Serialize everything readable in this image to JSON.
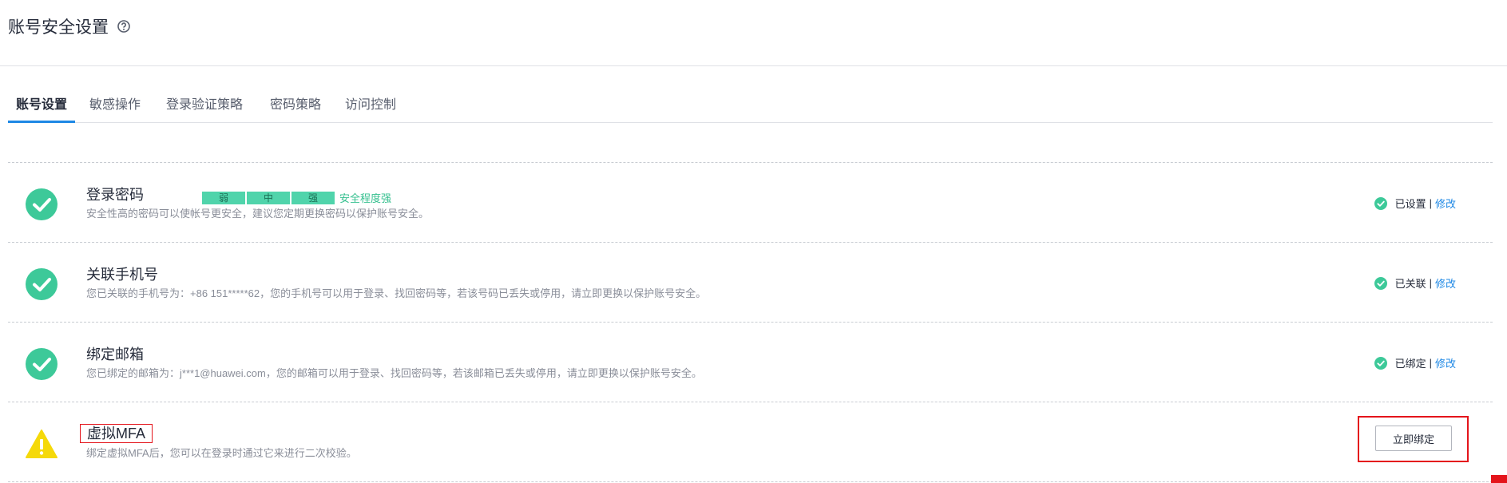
{
  "page": {
    "title": "账号安全设置"
  },
  "tabs": [
    {
      "label": "账号设置",
      "active": true
    },
    {
      "label": "敏感操作"
    },
    {
      "label": "登录验证策略"
    },
    {
      "label": "密码策略"
    },
    {
      "label": "访问控制"
    }
  ],
  "items": {
    "password": {
      "title": "登录密码",
      "desc": "安全性高的密码可以使帐号更安全，建议您定期更换密码以保护账号安全。",
      "strength": {
        "levels": [
          "弱",
          "中",
          "强"
        ],
        "label": "安全程度强"
      },
      "status": "已设置",
      "action": "修改"
    },
    "phone": {
      "title": "关联手机号",
      "desc": "您已关联的手机号为：+86 151*****62，您的手机号可以用于登录、找回密码等，若该号码已丢失或停用，请立即更换以保护账号安全。",
      "status": "已关联",
      "action": "修改"
    },
    "email": {
      "title": "绑定邮箱",
      "desc": "您已绑定的邮箱为：j***1@huawei.com，您的邮箱可以用于登录、找回密码等，若该邮箱已丢失或停用，请立即更换以保护账号安全。",
      "status": "已绑定",
      "action": "修改"
    },
    "mfa": {
      "title": "虚拟MFA",
      "desc": "绑定虚拟MFA后，您可以在登录时通过它来进行二次校验。",
      "button": "立即绑定"
    }
  },
  "colors": {
    "ok": "#36c08f",
    "warn": "#fadb14",
    "link": "#1e88e5",
    "highlight": "#e4141b"
  }
}
